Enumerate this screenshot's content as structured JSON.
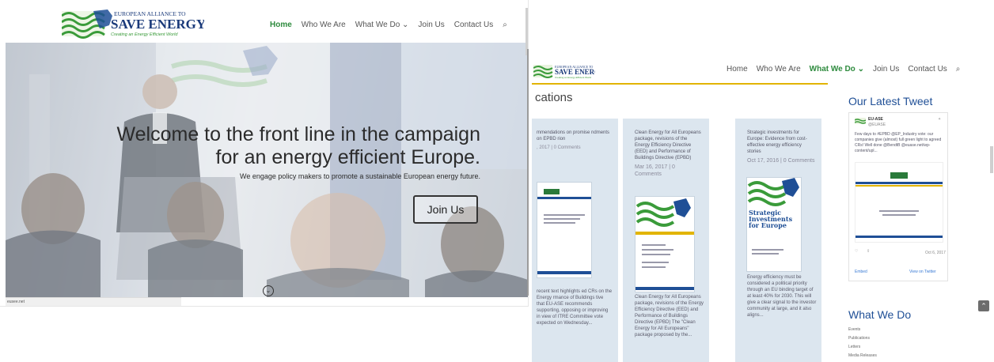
{
  "brand": {
    "line1": "EUROPEAN ALLIANCE TO",
    "line2": "SAVE ENERGY",
    "tagline": "Creating an Energy Efficient World"
  },
  "colors": {
    "accent_green": "#2e8b3e",
    "sidebar_blue": "#1f4f96",
    "gold": "#e2b400"
  },
  "front": {
    "nav": [
      "Home",
      "Who We Are",
      "What We Do",
      "Join Us",
      "Contact Us"
    ],
    "active": "Home",
    "dropdown_item": "What We Do",
    "hero": {
      "headline_line1": "Welcome to the front line in the campaign",
      "headline_line2": "for an energy efficient Europe.",
      "subheadline": "We engage policy makers to promote a sustainable European energy future.",
      "cta": "Join Us"
    },
    "status_url": "eusee.net"
  },
  "back": {
    "nav": [
      "Home",
      "Who We Are",
      "What We Do",
      "Join Us",
      "Contact Us"
    ],
    "active": "What We Do",
    "section_title": "cations",
    "cards": [
      {
        "title": "mmendations on promise ndments on EPBD rion",
        "meta": ", 2017 | 0 Comments",
        "desc": "recent text highlights ed CRs on the Energy rmance of Buildings tive that EU-ASE recommends supporting, opposing or improving in view of ITRE Committee vote expected on Wednesday..."
      },
      {
        "title": "Clean Energy for All Europeans package, revisions of the Energy Efficiency Directive (EED) and Performance of Buildings Directive (EPBD)",
        "meta": "Mar 16, 2017 | 0 Comments",
        "desc": "Clean Energy for All Europeans package, revisions of the Energy Efficiency Directive (EED) and Performance of Buildings Directive (EPBD) The \"Clean Energy for All Europeans\" package proposed by the..."
      },
      {
        "title": "Strategic investments for Europe: Evidence from cost-effective energy efficiency stories",
        "meta": "Oct 17, 2016 | 0 Comments",
        "thumb_text": "Strategic Investments for Europe",
        "desc": "Energy efficiency must be considered a political priority through an EU binding target of at least 40% for 2030. This will give a clear signal to the investor community at large, and it also aligns..."
      }
    ],
    "sidebar": {
      "tweet_heading": "Our Latest Tweet",
      "tweet_account": "EU-ASE",
      "tweet_handle": "@EUASE",
      "tweet_text": "Few days to #EPBD @EP_Industry vote: our companies give (almost) full green light to agreed CRs! Well done @BendtB @euase.net/wp-content/upl...",
      "tweet_date": "Oct 6, 2017",
      "embed_label": "Embed",
      "view_label": "View on Twitter",
      "what_heading": "What We Do",
      "what_items": [
        "Events",
        "Publications",
        "Letters",
        "Media Releases"
      ]
    }
  }
}
